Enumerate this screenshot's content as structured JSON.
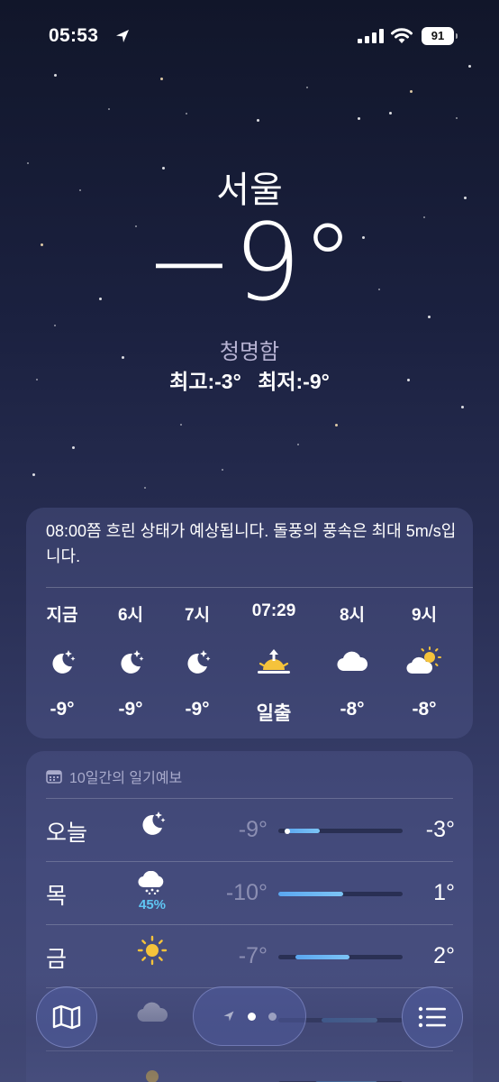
{
  "status_bar": {
    "time": "05:53",
    "battery": "91"
  },
  "hero": {
    "city": "서울",
    "temperature": "−9°",
    "condition": "청명함",
    "high": "최고:-3°",
    "low": "최저:-9°"
  },
  "hourly": {
    "summary": "08:00쯤 흐린 상태가 예상됩니다. 돌풍의 풍속은 최대 5m/s입니다.",
    "items": [
      {
        "label": "지금",
        "icon": "moon-stars-icon",
        "value": "-9°"
      },
      {
        "label": "6시",
        "icon": "moon-stars-icon",
        "value": "-9°"
      },
      {
        "label": "7시",
        "icon": "moon-stars-icon",
        "value": "-9°"
      },
      {
        "label": "07:29",
        "icon": "sunrise-icon",
        "value": "일출"
      },
      {
        "label": "8시",
        "icon": "cloud-icon",
        "value": "-8°"
      },
      {
        "label": "9시",
        "icon": "sun-cloud-icon",
        "value": "-8°"
      }
    ]
  },
  "daily": {
    "header": "10일간의 일기예보",
    "days": [
      {
        "name": "오늘",
        "icon": "moon-stars-icon",
        "pop": "",
        "low": "-9°",
        "high": "-3°",
        "range_start": 0.05,
        "range_end": 0.33,
        "current_dot": 0.07
      },
      {
        "name": "목",
        "icon": "cloud-snow-icon",
        "pop": "45%",
        "low": "-10°",
        "high": "1°",
        "range_start": 0.0,
        "range_end": 0.52
      },
      {
        "name": "금",
        "icon": "sun-icon",
        "pop": "",
        "low": "-7°",
        "high": "2°",
        "range_start": 0.14,
        "range_end": 0.57
      },
      {
        "name": "",
        "icon": "cloud-icon",
        "pop": "",
        "low": "",
        "high": "",
        "range_start": 0.35,
        "range_end": 0.8
      },
      {
        "name": "",
        "icon": "sun-icon",
        "pop": "",
        "low": "",
        "high": "",
        "range_start": 0.3,
        "range_end": 0.8
      }
    ]
  },
  "colors": {
    "accent_temp_bar": "#5aa6f0",
    "precip": "#5fc6f3",
    "sun": "#f5c33b"
  }
}
